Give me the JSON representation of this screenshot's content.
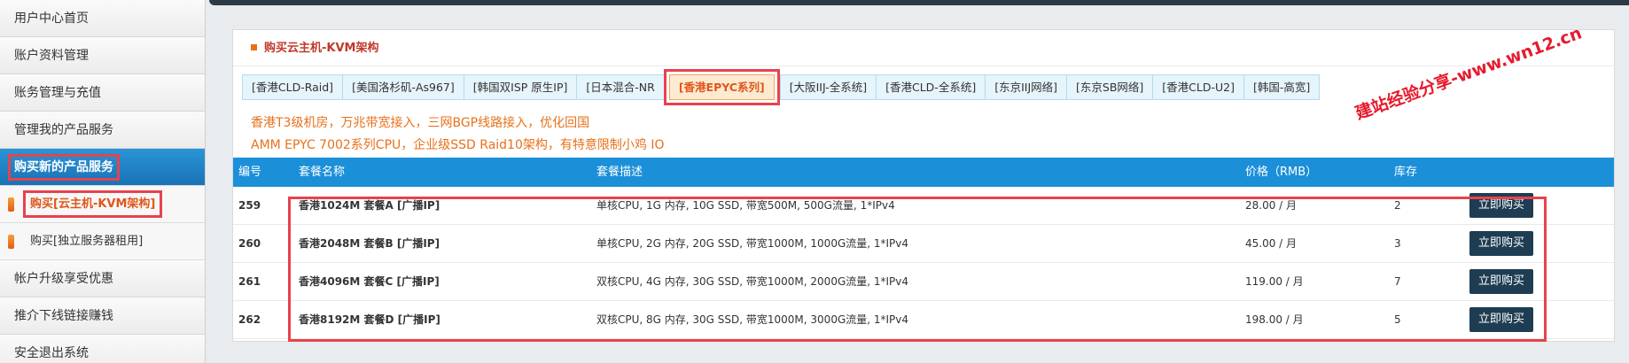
{
  "sidebar": {
    "items": [
      {
        "label": "用户中心首页"
      },
      {
        "label": "账户资料管理"
      },
      {
        "label": "账务管理与充值"
      },
      {
        "label": "管理我的产品服务"
      },
      {
        "label": "购买新的产品服务"
      },
      {
        "label": "帐户升级享受优惠"
      },
      {
        "label": "推介下线链接赚钱"
      },
      {
        "label": "安全退出系统"
      }
    ],
    "subitems": [
      {
        "label": "购买[云主机-KVM架构]"
      },
      {
        "label": "购买[独立服务器租用]"
      }
    ]
  },
  "panel": {
    "title": "购买云主机-KVM架构"
  },
  "tabs": [
    {
      "label": "[香港CLD-Raid]"
    },
    {
      "label": "[美国洛杉矶-As967]"
    },
    {
      "label": "[韩国双ISP 原生IP]"
    },
    {
      "label": "[日本混合-NR"
    },
    {
      "label": "[香港EPYC系列]"
    },
    {
      "label": "[大阪IIJ-全系统]"
    },
    {
      "label": "[香港CLD-全系统]"
    },
    {
      "label": "[东京IIJ网络]"
    },
    {
      "label": "[东京SB网络]"
    },
    {
      "label": "[香港CLD-U2]"
    },
    {
      "label": "[韩国-高宽]"
    }
  ],
  "description": [
    "香港T3级机房，万兆带宽接入，三网BGP线路接入，优化回国",
    "AMM EPYC 7002系列CPU，企业级SSD Raid10架构，有特意限制小鸡 IO"
  ],
  "table": {
    "headers": [
      "编号",
      "套餐名称",
      "套餐描述",
      "价格（RMB）",
      "库存"
    ],
    "rows": [
      {
        "id": "259",
        "name": "香港1024M 套餐A [广播IP]",
        "spec": "单核CPU, 1G 内存, 10G SSD, 带宽500M, 500G流量, 1*IPv4",
        "price": "28.00 / 月",
        "stock": "2",
        "action": "立即购买"
      },
      {
        "id": "260",
        "name": "香港2048M 套餐B [广播IP]",
        "spec": "单核CPU, 2G 内存, 20G SSD, 带宽1000M, 1000G流量, 1*IPv4",
        "price": "45.00 / 月",
        "stock": "3",
        "action": "立即购买"
      },
      {
        "id": "261",
        "name": "香港4096M 套餐C [广播IP]",
        "spec": "双核CPU, 4G 内存, 30G SSD, 带宽1000M, 2000G流量, 1*IPv4",
        "price": "119.00 / 月",
        "stock": "7",
        "action": "立即购买"
      },
      {
        "id": "262",
        "name": "香港8192M 套餐D [广播IP]",
        "spec": "双核CPU, 8G 内存, 30G SSD, 带宽1000M, 3000G流量, 1*IPv4",
        "price": "198.00 / 月",
        "stock": "5",
        "action": "立即购买"
      }
    ]
  },
  "watermark": "建站经验分享-www.wn12.cn",
  "colors": {
    "accent_blue": "#1c8fd9",
    "highlight_red": "#e8424d",
    "orange_text": "#e8701a",
    "buy_button": "#1e3d52"
  }
}
